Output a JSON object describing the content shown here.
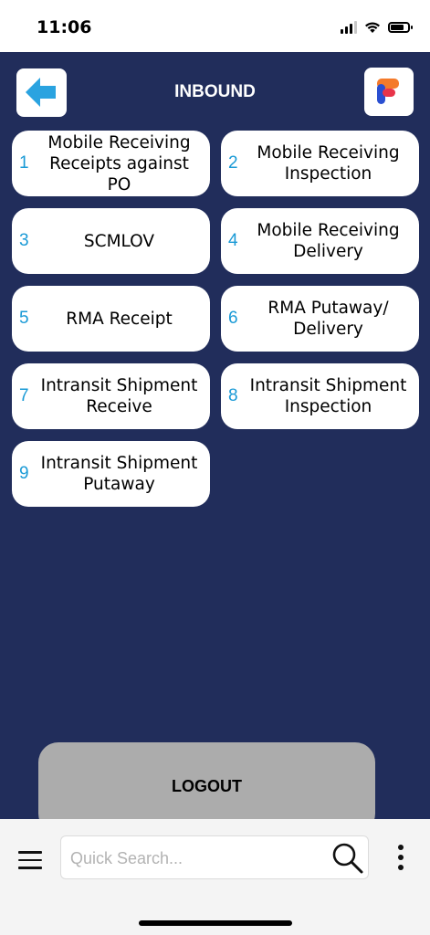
{
  "status": {
    "time": "11:06"
  },
  "header": {
    "title": "INBOUND"
  },
  "menu_items": [
    {
      "number": "1",
      "label": "Mobile Receiving Receipts against PO"
    },
    {
      "number": "2",
      "label": "Mobile Receiving Inspection"
    },
    {
      "number": "3",
      "label": "SCMLOV"
    },
    {
      "number": "4",
      "label": "Mobile Receiving Delivery"
    },
    {
      "number": "5",
      "label": "RMA Receipt"
    },
    {
      "number": "6",
      "label": "RMA Putaway/ Delivery"
    },
    {
      "number": "7",
      "label": "Intransit Shipment Receive"
    },
    {
      "number": "8",
      "label": "Intransit Shipment Inspection"
    },
    {
      "number": "9",
      "label": "Intransit Shipment Putaway"
    }
  ],
  "logout": {
    "label": "LOGOUT"
  },
  "bottom": {
    "search_placeholder": "Quick Search..."
  },
  "colors": {
    "background": "#212d5b",
    "accent": "#1a9ad6",
    "logout": "#acacac"
  },
  "icons": [
    "back-arrow-icon",
    "brand-logo-icon",
    "menu-icon",
    "search-icon",
    "more-vertical-icon"
  ]
}
